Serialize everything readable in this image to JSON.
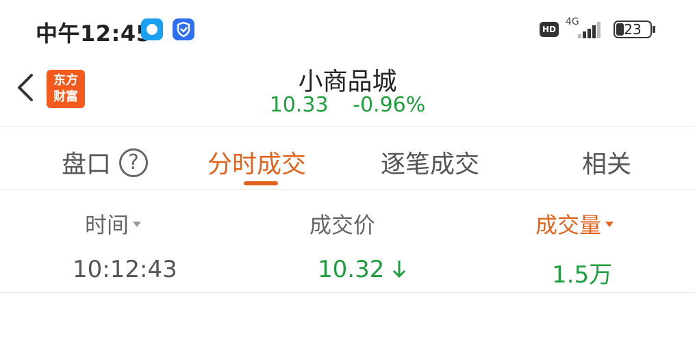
{
  "status_bar": {
    "time": "中午12:45",
    "hd": "HD",
    "network": "4G",
    "battery": "23",
    "battery_level": 0.23
  },
  "header": {
    "logo_line1": "东方",
    "logo_line2": "财富",
    "title": "小商品城",
    "price": "10.33",
    "change_pct": "-0.96%"
  },
  "tabs": [
    {
      "label": "盘口"
    },
    {
      "label": "分时成交"
    },
    {
      "label": "逐笔成交"
    },
    {
      "label": "相关"
    }
  ],
  "table": {
    "headers": {
      "time": "时间",
      "price": "成交价",
      "volume": "成交量"
    },
    "rows": [
      {
        "time": "10:12:43",
        "price": "10.32",
        "volume": "1.5万"
      }
    ]
  },
  "colors": {
    "accent": "#e2631e",
    "down": "#1e9e3e"
  },
  "icons": [
    "back-arrow-icon",
    "help-icon",
    "down-arrow-icon",
    "sort-caret-icon"
  ]
}
